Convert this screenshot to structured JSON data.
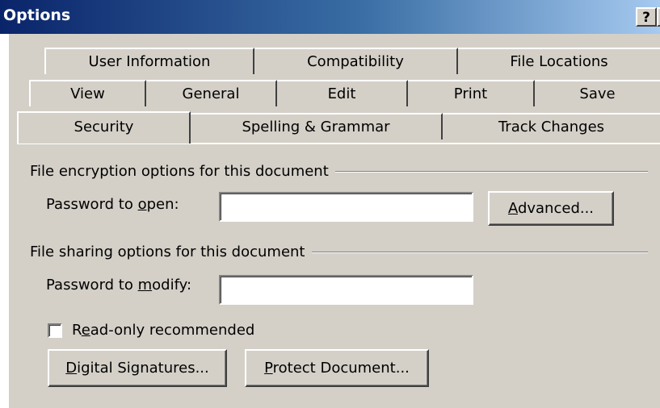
{
  "window": {
    "title": "Options",
    "help_button": "?",
    "close_button": "✕"
  },
  "tabs": {
    "row1": [
      "User Information",
      "Compatibility",
      "File Locations"
    ],
    "row2": [
      "View",
      "General",
      "Edit",
      "Print",
      "Save"
    ],
    "row3": [
      "Security",
      "Spelling & Grammar",
      "Track Changes"
    ],
    "active": "Security"
  },
  "encryption": {
    "group_label": "File encryption options for this document",
    "password_open_pre": "Password to ",
    "password_open_key": "o",
    "password_open_post": "pen:",
    "password_open_value": "",
    "advanced_key": "A",
    "advanced_rest": "dvanced..."
  },
  "sharing": {
    "group_label": "File sharing options for this document",
    "password_modify_pre": "Password to ",
    "password_modify_key": "m",
    "password_modify_post": "odify:",
    "password_modify_value": "",
    "readonly_pre": "R",
    "readonly_key": "e",
    "readonly_post": "ad-only recommended",
    "readonly_checked": false,
    "digital_key": "D",
    "digital_rest": "igital Signatures...",
    "protect_key": "P",
    "protect_rest": "rotect Document..."
  }
}
